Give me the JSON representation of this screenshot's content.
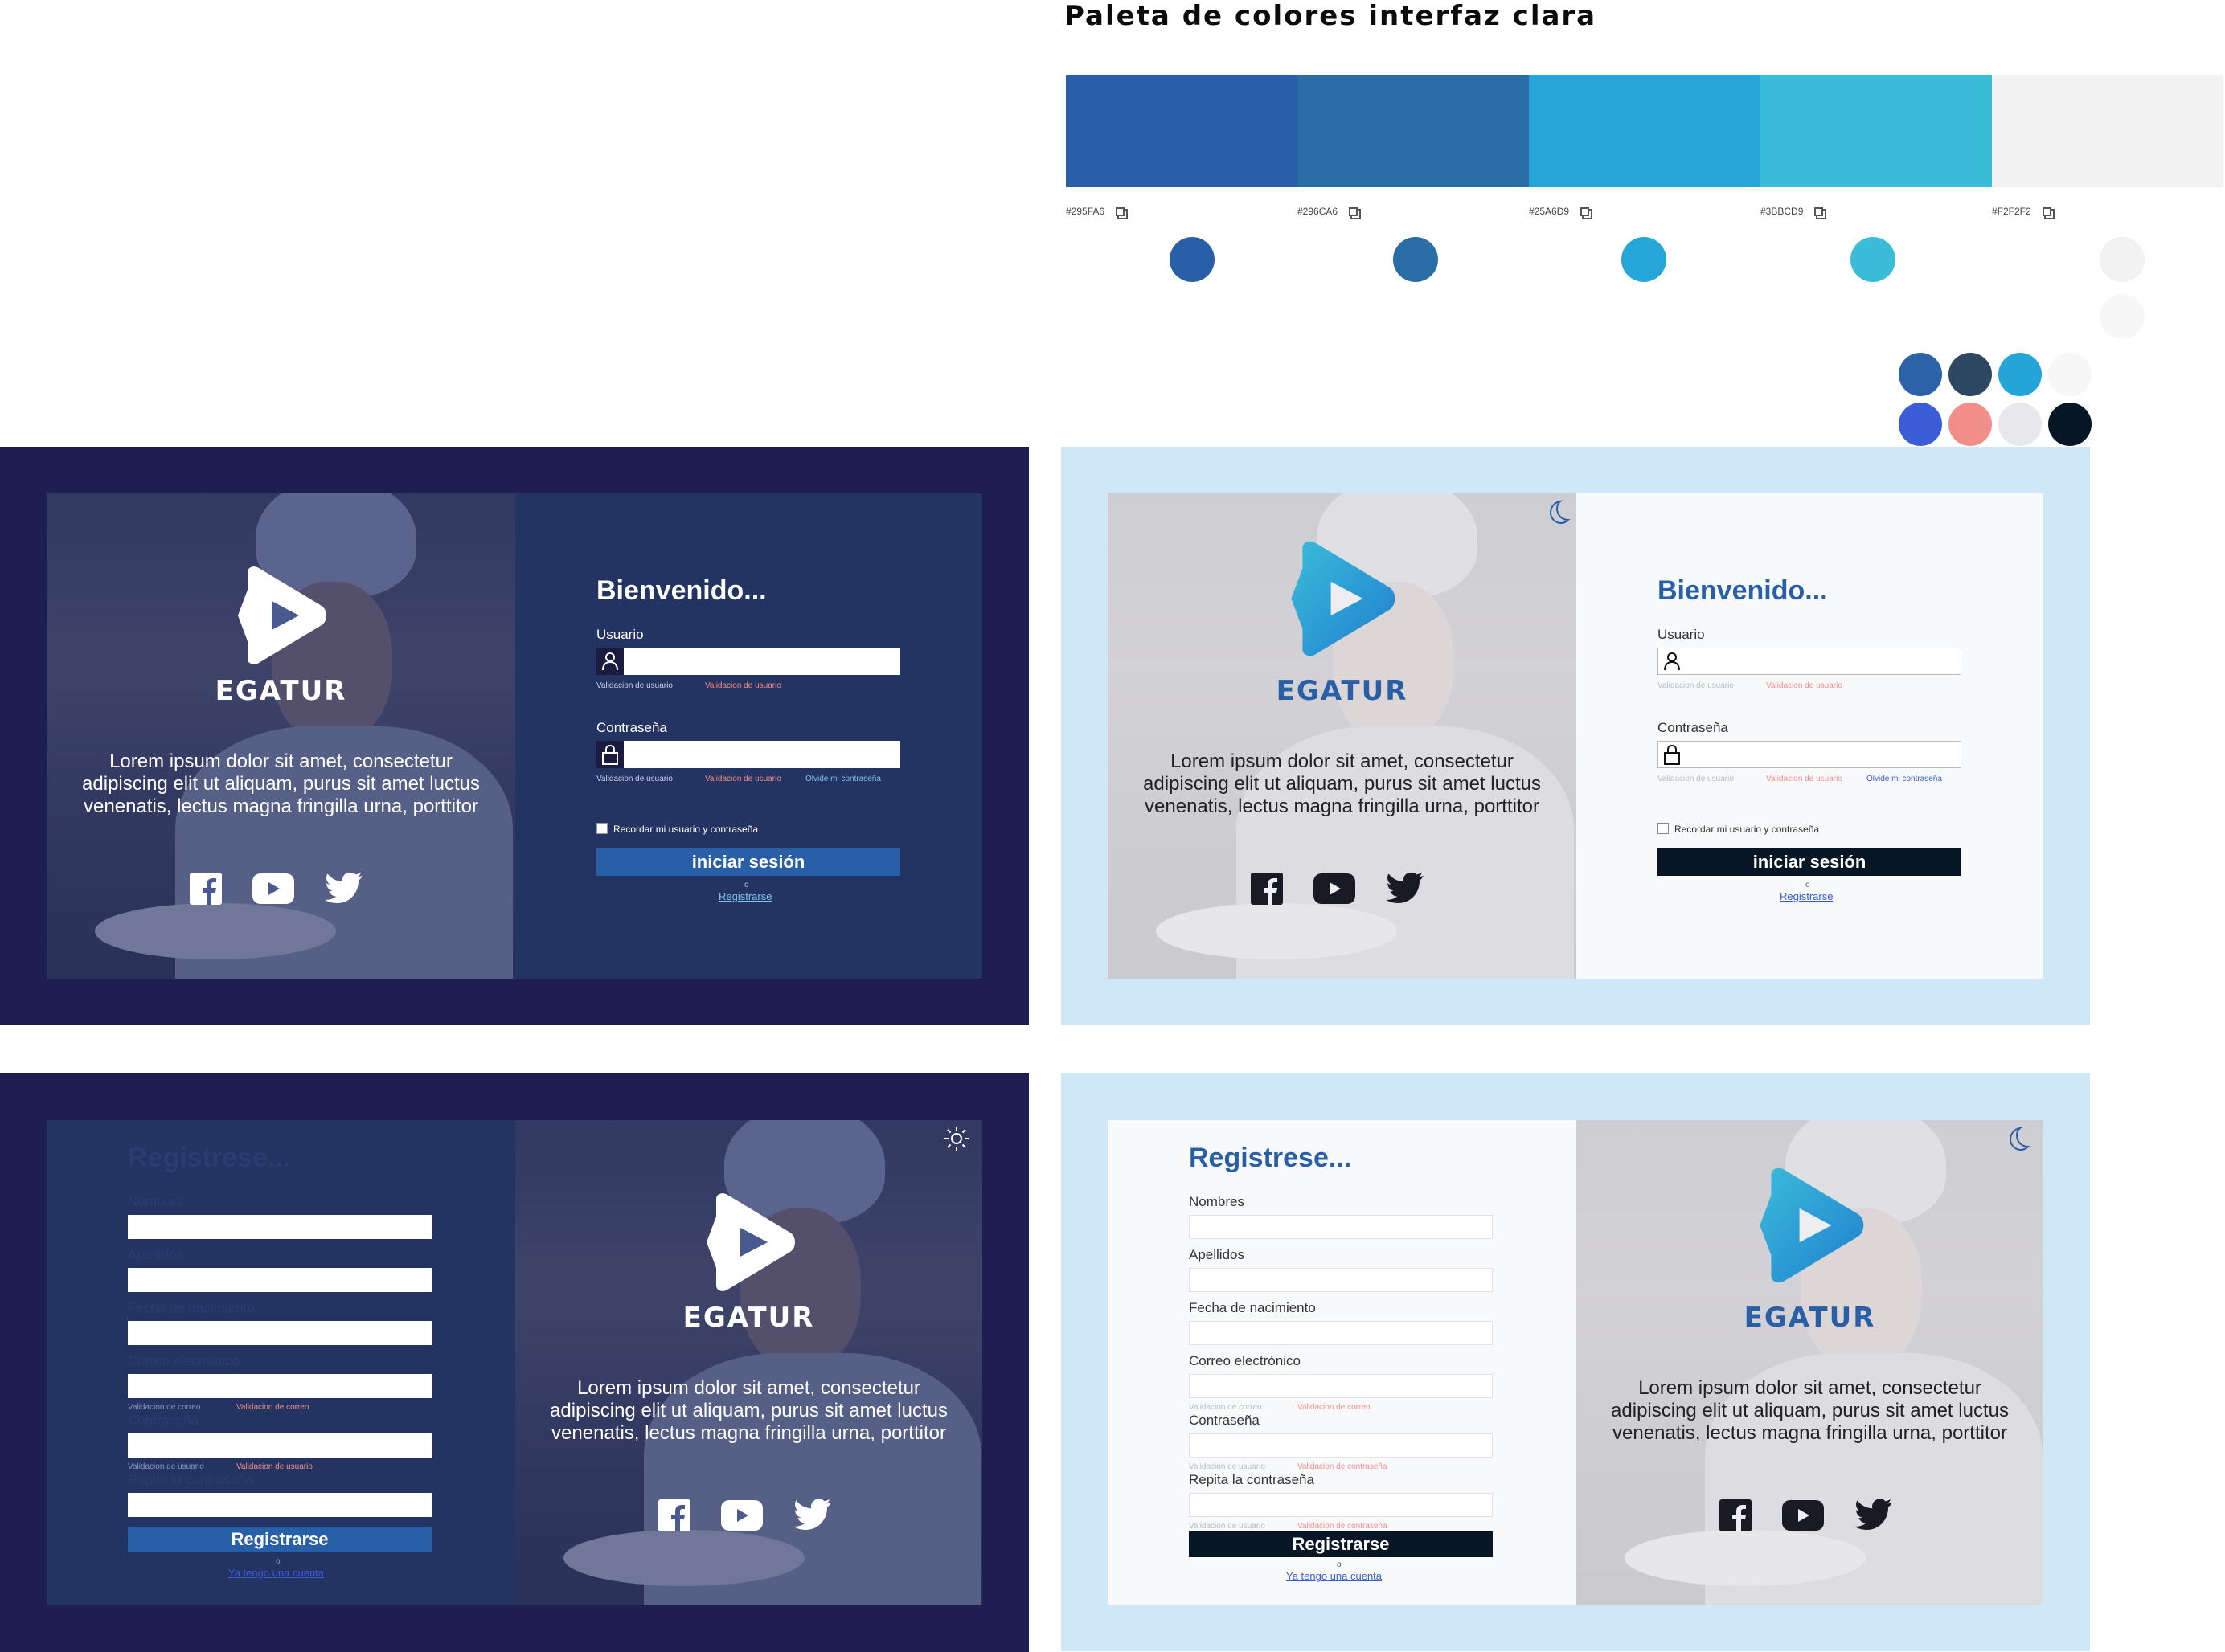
{
  "palette": {
    "title": "Paleta de colores interfaz clara",
    "swatches": [
      {
        "hex": "#295FA6",
        "label": "#295FA6"
      },
      {
        "hex": "#296CA6",
        "label": "#296CA6"
      },
      {
        "hex": "#25A6D9",
        "label": "#25A6D9"
      },
      {
        "hex": "#3BBCD9",
        "label": "#3BBCD9"
      },
      {
        "hex": "#F2F2F2",
        "label": "#F2F2F2"
      }
    ],
    "extra_colors": [
      "#2B62A8",
      "#2E4863",
      "#24A5DA",
      "#F7F7F7",
      "#3A5DD6",
      "#F28E8A",
      "#E8E8EC",
      "#061624"
    ]
  },
  "colors": {
    "dark_frame": "#1E1E52",
    "dark_panel": "#243462",
    "light_frame": "#CFE8F7",
    "light_panel": "#F8F9FB",
    "primary": "#295FA6",
    "black_btn": "#061624",
    "error": "#F28E8A",
    "link_dark": "#7CC0F0",
    "link_light": "#3A5DD6"
  },
  "brand": {
    "name": "EGATUR",
    "tagline": "Lorem ipsum dolor sit amet, consectetur adipiscing elit ut aliquam, purus sit amet luctus venenatis, lectus magna fringilla urna, porttitor"
  },
  "social_icons": [
    "facebook-icon",
    "youtube-icon",
    "twitter-icon"
  ],
  "login": {
    "title": "Bienvenido...",
    "user_label": "Usuario",
    "password_label": "Contraseña",
    "user_validation": "Validacion de usuario",
    "user_validation_error": "Validacion de usuario",
    "forgot": "Olvide mi contraseña",
    "remember": "Recordar mi usuario y contraseña",
    "submit": "iniciar sesión",
    "or": "o",
    "register_link": "Registrarse"
  },
  "register": {
    "title": "Registrese...",
    "names_label": "Nombres",
    "surnames_label": "Apellidos",
    "birth_label": "Fecha de nacimiento",
    "email_label": "Correo electrónico",
    "email_validation": "Validacion de correo",
    "email_validation_error": "Validacion de correo",
    "password_label": "Contraseña",
    "password_validation": "Validacion de usuario",
    "password_validation_error_dark": "Validacion de usuario",
    "password_validation_error": "Validacion de contraseña",
    "repeat_label": "Repita la contraseña",
    "repeat_validation": "Validacion de usuario",
    "repeat_validation_error": "Validacion de contraseña",
    "submit": "Registrarse",
    "or": "o",
    "have_account_link": "Ya tengo una cuenta"
  }
}
